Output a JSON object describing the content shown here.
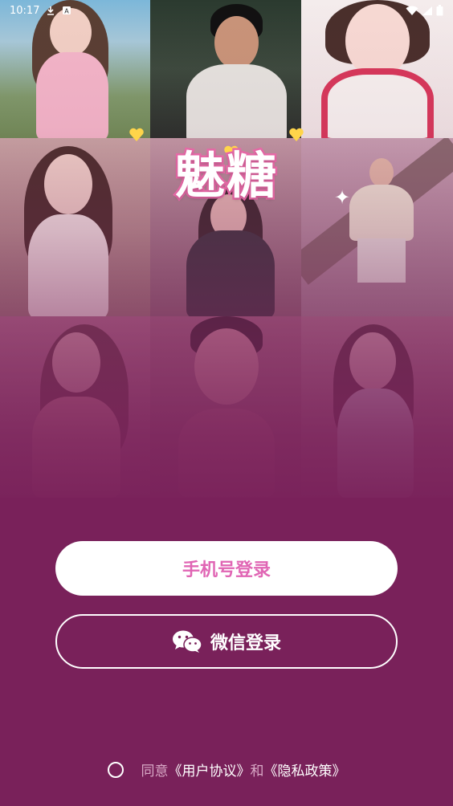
{
  "status_bar": {
    "time": "10:17",
    "icons": [
      "download-icon",
      "a-icon",
      "wifi-icon",
      "signal-icon",
      "battery-icon"
    ]
  },
  "logo": {
    "text": "魅糖",
    "colors": {
      "fill": "#ffffff",
      "stroke": "#e86aa8",
      "heart": "#ffd54a"
    }
  },
  "buttons": {
    "phone_login": "手机号登录",
    "wechat_login": "微信登录"
  },
  "agreement": {
    "prefix": "同意",
    "user_agreement": "《用户协议》",
    "conjunction": "和",
    "privacy_policy": "《隐私政策》"
  },
  "colors": {
    "background": "#79215a",
    "accent_pink": "#e065b4",
    "white": "#ffffff"
  }
}
